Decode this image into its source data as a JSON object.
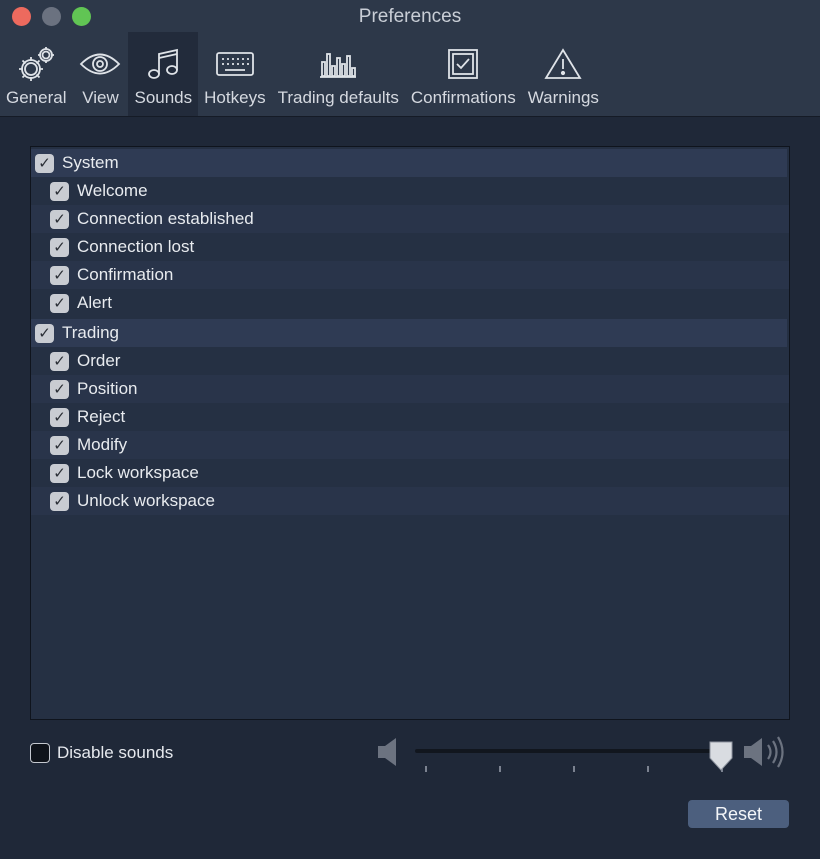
{
  "window": {
    "title": "Preferences"
  },
  "toolbar": {
    "items": [
      {
        "label": "General",
        "icon": "gears-icon"
      },
      {
        "label": "View",
        "icon": "eye-icon"
      },
      {
        "label": "Sounds",
        "icon": "music-note-icon",
        "active": true
      },
      {
        "label": "Hotkeys",
        "icon": "keyboard-icon"
      },
      {
        "label": "Trading defaults",
        "icon": "bar-chart-icon"
      },
      {
        "label": "Confirmations",
        "icon": "checkbox-icon"
      },
      {
        "label": "Warnings",
        "icon": "warning-icon"
      }
    ]
  },
  "sounds": {
    "groups": [
      {
        "label": "System",
        "checked": true,
        "items": [
          {
            "label": "Welcome",
            "checked": true
          },
          {
            "label": "Connection established",
            "checked": true
          },
          {
            "label": "Connection lost",
            "checked": true
          },
          {
            "label": "Confirmation",
            "checked": true
          },
          {
            "label": "Alert",
            "checked": true
          }
        ]
      },
      {
        "label": "Trading",
        "checked": true,
        "items": [
          {
            "label": "Order",
            "checked": true
          },
          {
            "label": "Position",
            "checked": true
          },
          {
            "label": "Reject",
            "checked": true
          },
          {
            "label": "Modify",
            "checked": true
          },
          {
            "label": "Lock workspace",
            "checked": true
          },
          {
            "label": "Unlock workspace",
            "checked": true
          }
        ]
      }
    ]
  },
  "controls": {
    "disable_sounds_label": "Disable sounds",
    "disable_sounds_checked": false,
    "volume_level": 1.0,
    "reset_label": "Reset"
  }
}
